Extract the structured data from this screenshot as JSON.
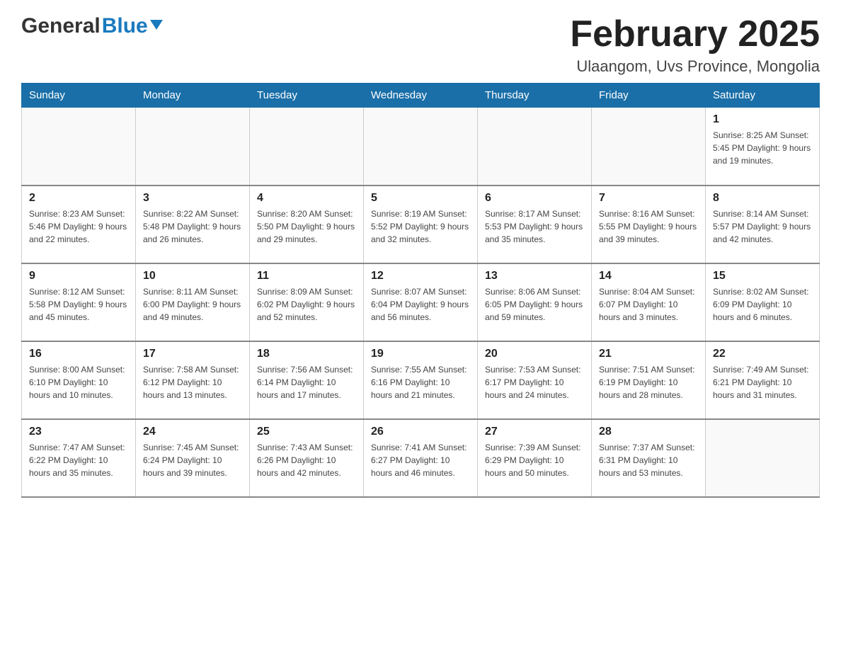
{
  "logo": {
    "general": "General",
    "blue": "Blue"
  },
  "header": {
    "title": "February 2025",
    "subtitle": "Ulaangom, Uvs Province, Mongolia"
  },
  "weekdays": [
    "Sunday",
    "Monday",
    "Tuesday",
    "Wednesday",
    "Thursday",
    "Friday",
    "Saturday"
  ],
  "weeks": [
    [
      {
        "day": "",
        "info": ""
      },
      {
        "day": "",
        "info": ""
      },
      {
        "day": "",
        "info": ""
      },
      {
        "day": "",
        "info": ""
      },
      {
        "day": "",
        "info": ""
      },
      {
        "day": "",
        "info": ""
      },
      {
        "day": "1",
        "info": "Sunrise: 8:25 AM\nSunset: 5:45 PM\nDaylight: 9 hours and 19 minutes."
      }
    ],
    [
      {
        "day": "2",
        "info": "Sunrise: 8:23 AM\nSunset: 5:46 PM\nDaylight: 9 hours and 22 minutes."
      },
      {
        "day": "3",
        "info": "Sunrise: 8:22 AM\nSunset: 5:48 PM\nDaylight: 9 hours and 26 minutes."
      },
      {
        "day": "4",
        "info": "Sunrise: 8:20 AM\nSunset: 5:50 PM\nDaylight: 9 hours and 29 minutes."
      },
      {
        "day": "5",
        "info": "Sunrise: 8:19 AM\nSunset: 5:52 PM\nDaylight: 9 hours and 32 minutes."
      },
      {
        "day": "6",
        "info": "Sunrise: 8:17 AM\nSunset: 5:53 PM\nDaylight: 9 hours and 35 minutes."
      },
      {
        "day": "7",
        "info": "Sunrise: 8:16 AM\nSunset: 5:55 PM\nDaylight: 9 hours and 39 minutes."
      },
      {
        "day": "8",
        "info": "Sunrise: 8:14 AM\nSunset: 5:57 PM\nDaylight: 9 hours and 42 minutes."
      }
    ],
    [
      {
        "day": "9",
        "info": "Sunrise: 8:12 AM\nSunset: 5:58 PM\nDaylight: 9 hours and 45 minutes."
      },
      {
        "day": "10",
        "info": "Sunrise: 8:11 AM\nSunset: 6:00 PM\nDaylight: 9 hours and 49 minutes."
      },
      {
        "day": "11",
        "info": "Sunrise: 8:09 AM\nSunset: 6:02 PM\nDaylight: 9 hours and 52 minutes."
      },
      {
        "day": "12",
        "info": "Sunrise: 8:07 AM\nSunset: 6:04 PM\nDaylight: 9 hours and 56 minutes."
      },
      {
        "day": "13",
        "info": "Sunrise: 8:06 AM\nSunset: 6:05 PM\nDaylight: 9 hours and 59 minutes."
      },
      {
        "day": "14",
        "info": "Sunrise: 8:04 AM\nSunset: 6:07 PM\nDaylight: 10 hours and 3 minutes."
      },
      {
        "day": "15",
        "info": "Sunrise: 8:02 AM\nSunset: 6:09 PM\nDaylight: 10 hours and 6 minutes."
      }
    ],
    [
      {
        "day": "16",
        "info": "Sunrise: 8:00 AM\nSunset: 6:10 PM\nDaylight: 10 hours and 10 minutes."
      },
      {
        "day": "17",
        "info": "Sunrise: 7:58 AM\nSunset: 6:12 PM\nDaylight: 10 hours and 13 minutes."
      },
      {
        "day": "18",
        "info": "Sunrise: 7:56 AM\nSunset: 6:14 PM\nDaylight: 10 hours and 17 minutes."
      },
      {
        "day": "19",
        "info": "Sunrise: 7:55 AM\nSunset: 6:16 PM\nDaylight: 10 hours and 21 minutes."
      },
      {
        "day": "20",
        "info": "Sunrise: 7:53 AM\nSunset: 6:17 PM\nDaylight: 10 hours and 24 minutes."
      },
      {
        "day": "21",
        "info": "Sunrise: 7:51 AM\nSunset: 6:19 PM\nDaylight: 10 hours and 28 minutes."
      },
      {
        "day": "22",
        "info": "Sunrise: 7:49 AM\nSunset: 6:21 PM\nDaylight: 10 hours and 31 minutes."
      }
    ],
    [
      {
        "day": "23",
        "info": "Sunrise: 7:47 AM\nSunset: 6:22 PM\nDaylight: 10 hours and 35 minutes."
      },
      {
        "day": "24",
        "info": "Sunrise: 7:45 AM\nSunset: 6:24 PM\nDaylight: 10 hours and 39 minutes."
      },
      {
        "day": "25",
        "info": "Sunrise: 7:43 AM\nSunset: 6:26 PM\nDaylight: 10 hours and 42 minutes."
      },
      {
        "day": "26",
        "info": "Sunrise: 7:41 AM\nSunset: 6:27 PM\nDaylight: 10 hours and 46 minutes."
      },
      {
        "day": "27",
        "info": "Sunrise: 7:39 AM\nSunset: 6:29 PM\nDaylight: 10 hours and 50 minutes."
      },
      {
        "day": "28",
        "info": "Sunrise: 7:37 AM\nSunset: 6:31 PM\nDaylight: 10 hours and 53 minutes."
      },
      {
        "day": "",
        "info": ""
      }
    ]
  ]
}
